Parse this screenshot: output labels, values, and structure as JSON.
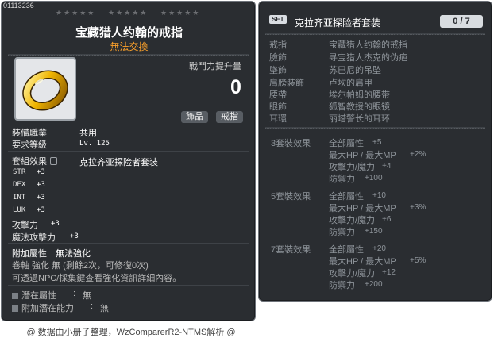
{
  "item": {
    "id": "01113236",
    "stars": [
      "★★★★★",
      "★★★★★",
      "★★★★★"
    ],
    "name": "宝藏猎人约翰的戒指",
    "trade": "無法交換",
    "power_label": "戰鬥力提升量",
    "power_value": "0",
    "tags": [
      "飾品",
      "戒指"
    ],
    "job_label": "裝備職業",
    "job_value": "共用",
    "req_label": "要求等級",
    "req_value": "Lv. 125",
    "set_label": "套組效果",
    "set_value": "克拉齐亚探险者套装",
    "stats": [
      {
        "name": "STR",
        "value": "+3"
      },
      {
        "name": "DEX",
        "value": "+3"
      },
      {
        "name": "INT",
        "value": "+3"
      },
      {
        "name": "LUK",
        "value": "+3"
      },
      {
        "name": "攻擊力",
        "value": "+3"
      },
      {
        "name": "魔法攻擊力",
        "value": "+3"
      }
    ],
    "extra_label": "附加屬性",
    "extra_value": "無法強化",
    "scroll_line": "卷軸 強化 無 (剩餘2次，可修復0次)",
    "info_line": "可透過NPC/採集鍵查看強化資訊詳細內容。",
    "potential": [
      {
        "label": "潛在屬性",
        "sep": ":",
        "value": "無"
      },
      {
        "label": "附加潛在能力",
        "sep": ":",
        "value": "無"
      }
    ]
  },
  "footer": "@ 数据由小册子整理，WzComparerR2-NTMS解析 @",
  "set": {
    "badge": "SET",
    "title": "克拉齐亚探险者套装",
    "count": "0 / 7",
    "pieces": [
      {
        "slot": "戒指",
        "name": "宝藏猎人约翰的戒指"
      },
      {
        "slot": "臉飾",
        "name": "寻宝猎人杰克的伪疤"
      },
      {
        "slot": "墜飾",
        "name": "苏巴尼的吊坠"
      },
      {
        "slot": "肩膀裝飾",
        "name": "卢坎的肩甲"
      },
      {
        "slot": "腰帶",
        "name": "埃尔帕姆的腰带"
      },
      {
        "slot": "眼飾",
        "name": "狐智教授的眼镜"
      },
      {
        "slot": "耳環",
        "name": "丽塔警长的耳环"
      }
    ],
    "effects": [
      {
        "title": "3套裝效果",
        "lines": [
          {
            "text": "全部屬性",
            "value": "+5"
          },
          {
            "text": "最大HP / 最大MP",
            "value": "+2%"
          },
          {
            "text": "攻擊力/魔力",
            "value": "+4"
          },
          {
            "text": "防禦力",
            "value": "+100"
          }
        ]
      },
      {
        "title": "5套裝效果",
        "lines": [
          {
            "text": "全部屬性",
            "value": "+10"
          },
          {
            "text": "最大HP / 最大MP",
            "value": "+3%"
          },
          {
            "text": "攻擊力/魔力",
            "value": "+6"
          },
          {
            "text": "防禦力",
            "value": "+150"
          }
        ]
      },
      {
        "title": "7套裝效果",
        "lines": [
          {
            "text": "全部屬性",
            "value": "+20"
          },
          {
            "text": "最大HP / 最大MP",
            "value": "+5%"
          },
          {
            "text": "攻擊力/魔力",
            "value": "+12"
          },
          {
            "text": "防禦力",
            "value": "+200"
          }
        ]
      }
    ]
  },
  "colors": {
    "panel": "#2a2d31",
    "border": "#6e737a",
    "trade": "#ffa22a",
    "set_text": "#8e949a",
    "ring_gold": "#f0b400"
  }
}
